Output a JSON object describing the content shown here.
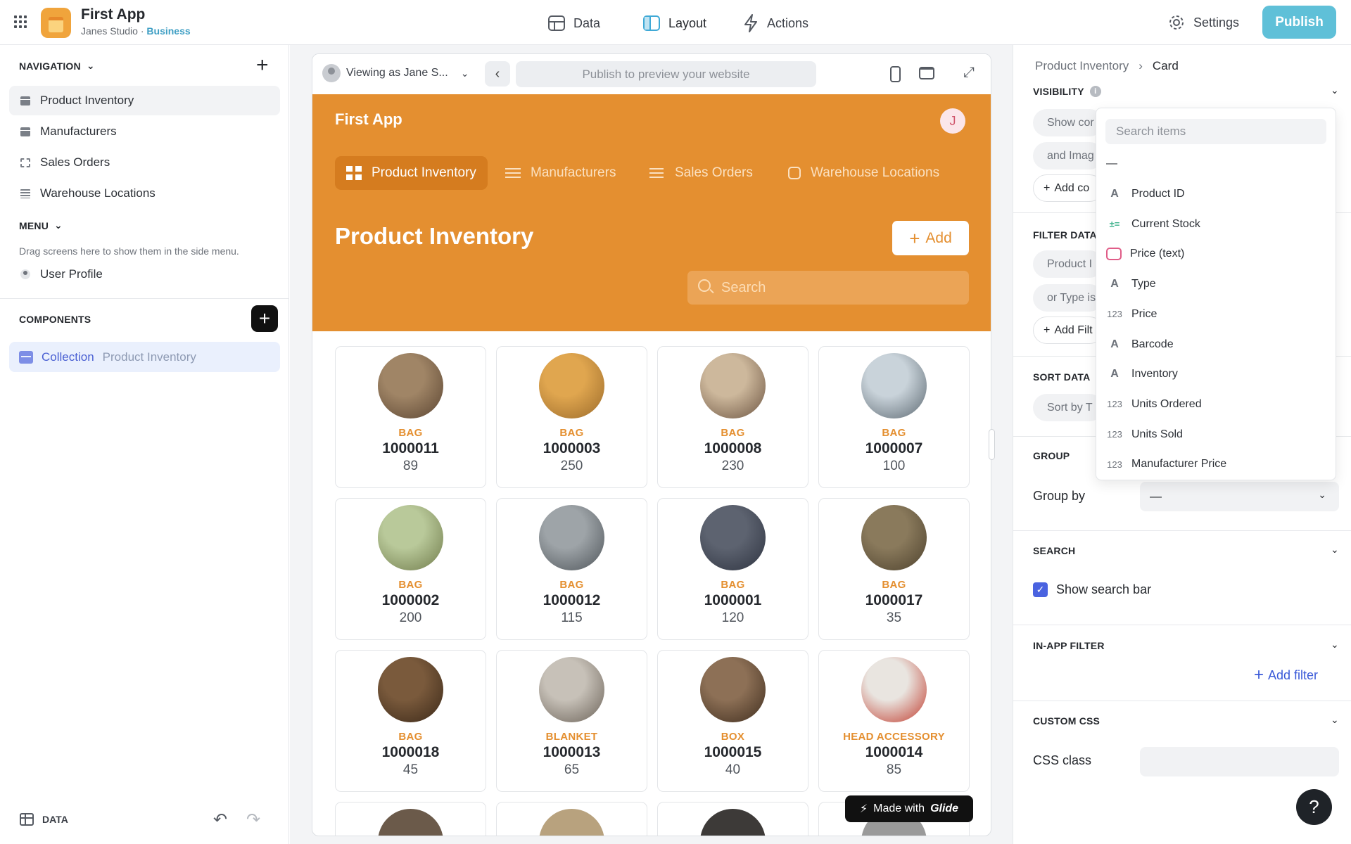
{
  "topbar": {
    "app_title": "First App",
    "studio": "Janes Studio",
    "separator": " · ",
    "plan": "Business",
    "nav": [
      {
        "label": "Data",
        "icon": "table-icon"
      },
      {
        "label": "Layout",
        "icon": "layout-icon",
        "active": true
      },
      {
        "label": "Actions",
        "icon": "lightning-icon"
      }
    ],
    "settings_label": "Settings",
    "publish_label": "Publish",
    "publish_color": "#5fc0d8"
  },
  "leftbar": {
    "navigation_header": "NAVIGATION",
    "nav_items": [
      {
        "label": "Product Inventory",
        "icon": "table-icon",
        "selected": true
      },
      {
        "label": "Manufacturers",
        "icon": "table-icon"
      },
      {
        "label": "Sales Orders",
        "icon": "focus-icon"
      },
      {
        "label": "Warehouse Locations",
        "icon": "list-icon"
      }
    ],
    "menu_header": "MENU",
    "menu_hint": "Drag screens here to show them in the side menu.",
    "menu_items": [
      {
        "label": "User Profile",
        "icon": "user-icon"
      }
    ],
    "components_header": "COMPONENTS",
    "component": {
      "type": "Collection",
      "source": "Product Inventory"
    },
    "footer_label": "DATA"
  },
  "preview": {
    "viewing_as": "Viewing as Jane S...",
    "url_placeholder": "Publish to preview your website",
    "app_name": "First App",
    "user_initial": "J",
    "accent_color": "#e48f30",
    "tabs": [
      {
        "label": "Product Inventory",
        "active": true
      },
      {
        "label": "Manufacturers"
      },
      {
        "label": "Sales Orders"
      },
      {
        "label": "Warehouse Locations"
      }
    ],
    "screen_title": "Product Inventory",
    "add_label": "Add",
    "search_placeholder": "Search",
    "cards": [
      {
        "type": "BAG",
        "id": "1000011",
        "qty": "89"
      },
      {
        "type": "BAG",
        "id": "1000003",
        "qty": "250"
      },
      {
        "type": "BAG",
        "id": "1000008",
        "qty": "230"
      },
      {
        "type": "BAG",
        "id": "1000007",
        "qty": "100"
      },
      {
        "type": "BAG",
        "id": "1000002",
        "qty": "200"
      },
      {
        "type": "BAG",
        "id": "1000012",
        "qty": "115"
      },
      {
        "type": "BAG",
        "id": "1000001",
        "qty": "120"
      },
      {
        "type": "BAG",
        "id": "1000017",
        "qty": "35"
      },
      {
        "type": "BAG",
        "id": "1000018",
        "qty": "45"
      },
      {
        "type": "BLANKET",
        "id": "1000013",
        "qty": "65"
      },
      {
        "type": "BOX",
        "id": "1000015",
        "qty": "40"
      },
      {
        "type": "HEAD ACCESSORY",
        "id": "1000014",
        "qty": "85"
      }
    ],
    "made_with": "Made with",
    "made_with_brand": "Glide"
  },
  "rightbar": {
    "breadcrumb": [
      "Product Inventory",
      "Card"
    ],
    "visibility_header": "VISIBILITY",
    "visibility_pills": [
      "Show cor",
      "and Imag"
    ],
    "add_condition": "Add co",
    "filter_header": "FILTER DATA",
    "filter_pills": [
      "Product I",
      "or Type is"
    ],
    "add_filter_short": "Add Filt",
    "sort_header": "SORT DATA",
    "sort_pill": "Sort by T",
    "group_header": "GROUP",
    "group_by_label": "Group by",
    "group_by_value": "—",
    "search_header": "SEARCH",
    "show_search_label": "Show search bar",
    "show_search_checked": true,
    "inapp_header": "IN-APP FILTER",
    "add_filter_label": "Add filter",
    "css_header": "CUSTOM CSS",
    "css_class_label": "CSS class",
    "help": "?"
  },
  "dropdown": {
    "search_placeholder": "Search items",
    "empty_option": "—",
    "items": [
      {
        "label": "Product ID",
        "icon": "text-type-icon"
      },
      {
        "label": "Current Stock",
        "icon": "math-icon"
      },
      {
        "label": "Price (text)",
        "icon": "chat-icon"
      },
      {
        "label": "Type",
        "icon": "text-type-icon"
      },
      {
        "label": "Price",
        "icon": "number-icon"
      },
      {
        "label": "Barcode",
        "icon": "text-type-icon"
      },
      {
        "label": "Inventory",
        "icon": "text-type-icon"
      },
      {
        "label": "Units Ordered",
        "icon": "number-icon"
      },
      {
        "label": "Units Sold",
        "icon": "number-icon"
      },
      {
        "label": "Manufacturer Price",
        "icon": "number-icon"
      }
    ]
  }
}
